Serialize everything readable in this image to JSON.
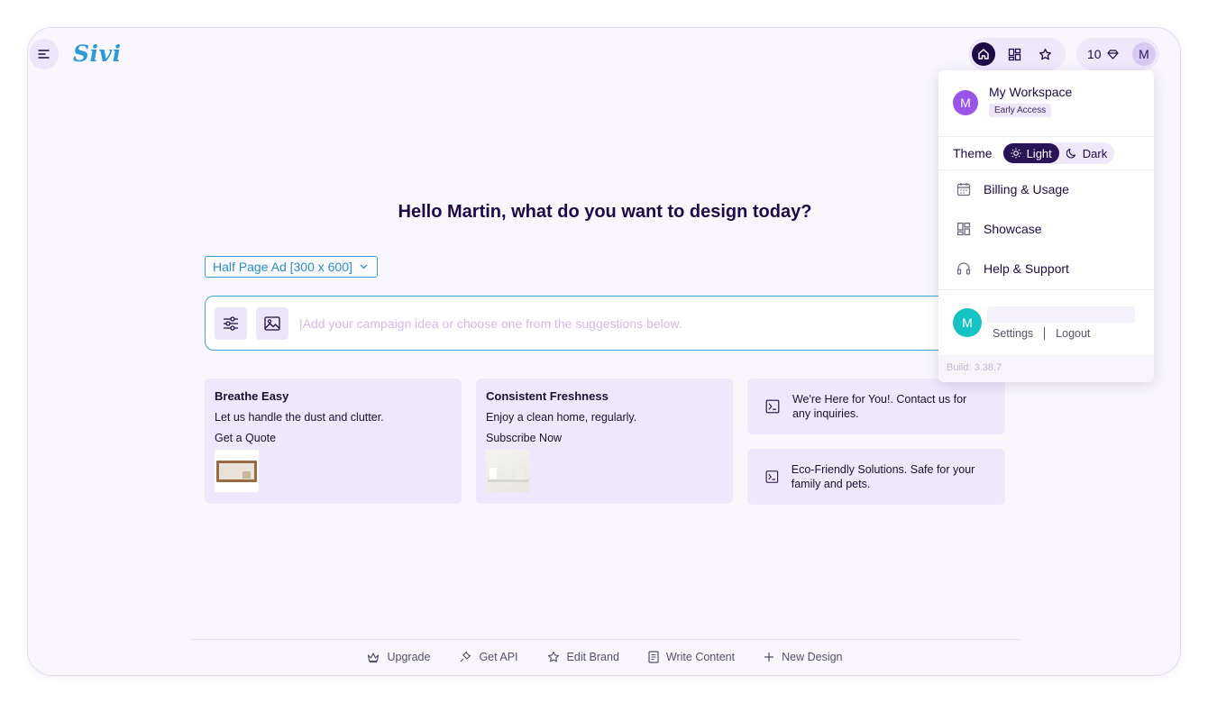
{
  "app": {
    "logo_text": "Sivi"
  },
  "header": {
    "nav_icons": [
      "home-icon",
      "showcase-grid-icon",
      "star-icon"
    ],
    "credits": "10",
    "avatar_initial": "M"
  },
  "main": {
    "headline": "Hello Martin, what do you want to design today?",
    "size_select": "Half Page Ad [300 x 600]",
    "prompt_placeholder": "|Add your campaign idea or choose one from the suggestions below.",
    "cards": [
      {
        "title": "Breathe Easy",
        "subtitle": "Let us handle the dust and clutter.",
        "cta": "Get a Quote"
      },
      {
        "title": "Consistent Freshness",
        "subtitle": "Enjoy a clean home, regularly.",
        "cta": "Subscribe Now"
      }
    ],
    "suggestions": [
      "We're Here for You!. Contact us for any inquiries.",
      "Eco-Friendly Solutions. Safe for your family and pets."
    ]
  },
  "footer": {
    "items": [
      "Upgrade",
      "Get API",
      "Edit Brand",
      "Write Content",
      "New Design"
    ]
  },
  "dropdown": {
    "workspace_initial": "M",
    "workspace_name": "My Workspace",
    "workspace_badge": "Early Access",
    "theme_label": "Theme",
    "theme_light": "Light",
    "theme_dark": "Dark",
    "theme_selected": "Light",
    "items": [
      "Billing & Usage",
      "Showcase",
      "Help & Support"
    ],
    "user_initial": "M",
    "settings": "Settings",
    "logout": "Logout",
    "build": "Build: 3.38.7"
  },
  "colors": {
    "brand_dark": "#1d0a46",
    "accent_blue": "#2b9ad8",
    "card_bg": "#efe7fb",
    "workspace_avatar": "#9a55e8",
    "user_avatar": "#16c2c4"
  }
}
